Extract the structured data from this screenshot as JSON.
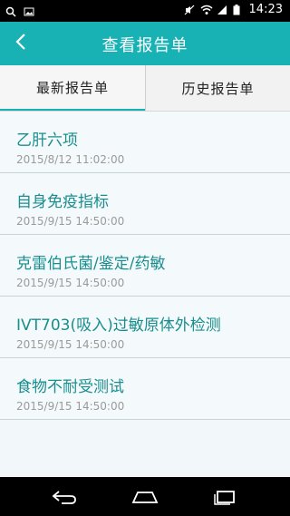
{
  "status_bar": {
    "time": "14:23",
    "icons": [
      "search-icon",
      "image-icon",
      "mute-icon",
      "wifi-icon",
      "signal-icon",
      "battery-icon"
    ]
  },
  "app_bar": {
    "title": "查看报告单",
    "back_icon": "chevron-left-icon"
  },
  "tabs": [
    {
      "label": "最新报告单",
      "active": true
    },
    {
      "label": "历史报告单",
      "active": false
    }
  ],
  "reports": [
    {
      "title": "乙肝六项",
      "time": "2015/8/12 11:02:00"
    },
    {
      "title": "自身免疫指标",
      "time": "2015/9/15 14:50:00"
    },
    {
      "title": "克雷伯氏菌/鉴定/药敏",
      "time": "2015/9/15 14:50:00"
    },
    {
      "title": "IVT703(吸入)过敏原体外检测",
      "time": "2015/9/15 14:50:00"
    },
    {
      "title": "食物不耐受测试",
      "time": "2015/9/15 14:50:00"
    }
  ],
  "colors": {
    "accent": "#18b2b5",
    "item_title": "#1a8d8f",
    "time_text": "#9a9a9a"
  },
  "nav_bar": {
    "icons": [
      "back-nav-icon",
      "home-nav-icon",
      "recents-nav-icon"
    ]
  }
}
